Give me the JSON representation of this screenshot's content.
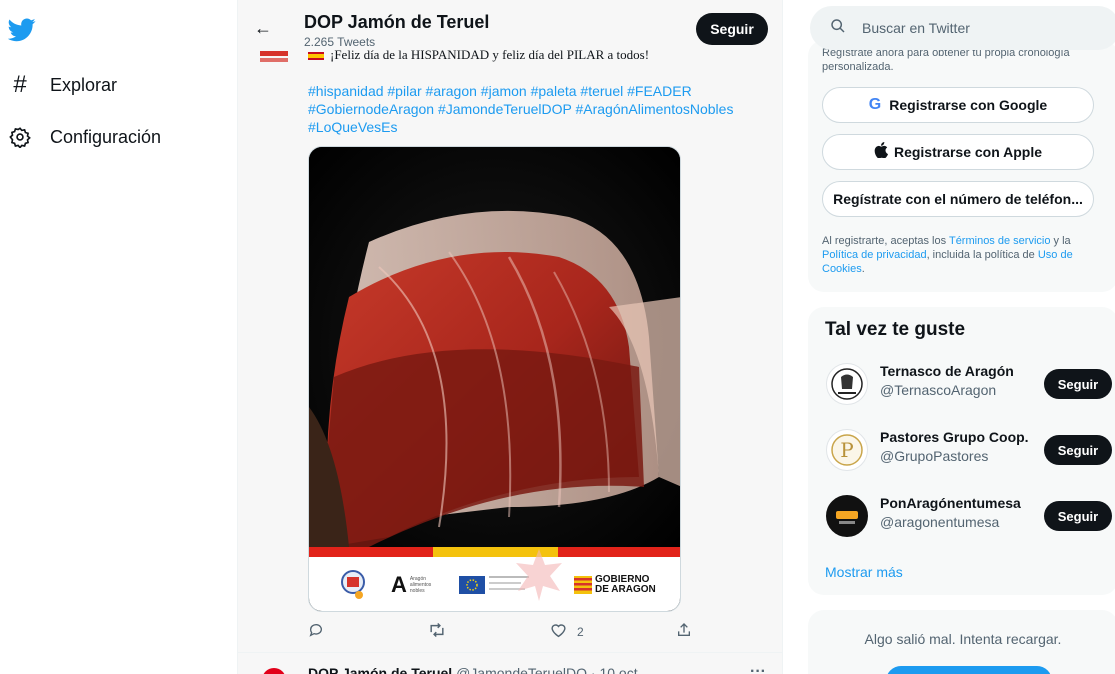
{
  "nav": {
    "logo_icon": "twitter-bird-icon",
    "explore": {
      "icon": "hash-icon",
      "label": "Explorar"
    },
    "settings": {
      "icon": "gear-icon",
      "label": "Configuración"
    }
  },
  "profile_header": {
    "name": "DOP Jamón de Teruel",
    "tweets_count": "2.265 Tweets",
    "follow_label": "Seguir"
  },
  "tweet": {
    "text_partial": "¡Feliz día de la HISPANIDAD y feliz día del PILAR a todos!",
    "hashtags_line1": "#hispanidad #pilar #aragon #jamon #paleta #teruel #FEADER",
    "hashtags_line2": "#GobiernodeAragon  #JamondeTeruelDOP #AragónAlimentosNobles",
    "hashtags_line3": "#LoQueVesEs",
    "media": {
      "stripe_colors": [
        "#e2231a",
        "#f4c20d",
        "#e2231a"
      ],
      "logo_aragon_label": "A",
      "logo_aragon_small": "Aragón alimentos nobles",
      "logo_gobierno_line1": "GOBIERNO",
      "logo_gobierno_line2": "DE ARAGON"
    },
    "actions": {
      "reply_icon": "reply-icon",
      "retweet_icon": "retweet-icon",
      "like_icon": "heart-icon",
      "like_count": "2",
      "share_icon": "share-icon"
    }
  },
  "next_tweet": {
    "name": "DOP Jamón de Teruel",
    "meta": "@JamondeTeruelDO · 10 oct.",
    "more": "···"
  },
  "search": {
    "placeholder": "Buscar en Twitter",
    "icon": "search-icon"
  },
  "signup": {
    "top_text": "Regístrate ahora para obtener tu propia cronología personalizada.",
    "google_label": "Registrarse con Google",
    "apple_label": "Registrarse con Apple",
    "phone_label": "Regístrate con el número de teléfon...",
    "legal_prefix": "Al registrarte, aceptas los ",
    "legal_terms": "Términos de servicio",
    "legal_mid": " y la ",
    "legal_privacy": "Política de privacidad",
    "legal_mid2": ", incluida la política de ",
    "legal_cookies": "Uso de Cookies",
    "legal_end": "."
  },
  "who_to_follow": {
    "title": "Tal vez te guste",
    "items": [
      {
        "name": "Ternasco de Aragón",
        "handle": "@TernascoAragon",
        "follow": "Seguir"
      },
      {
        "name": "Pastores Grupo Coop.",
        "handle": "@GrupoPastores",
        "follow": "Seguir"
      },
      {
        "name": "PonAragónentumesa",
        "handle": "@aragonentumesa",
        "follow": "Seguir"
      }
    ],
    "show_more": "Mostrar más"
  },
  "error_card": {
    "text": "Algo salió mal. Intenta recargar."
  },
  "colors": {
    "accent": "#1d9bf0",
    "dark_button": "#0f1419"
  }
}
